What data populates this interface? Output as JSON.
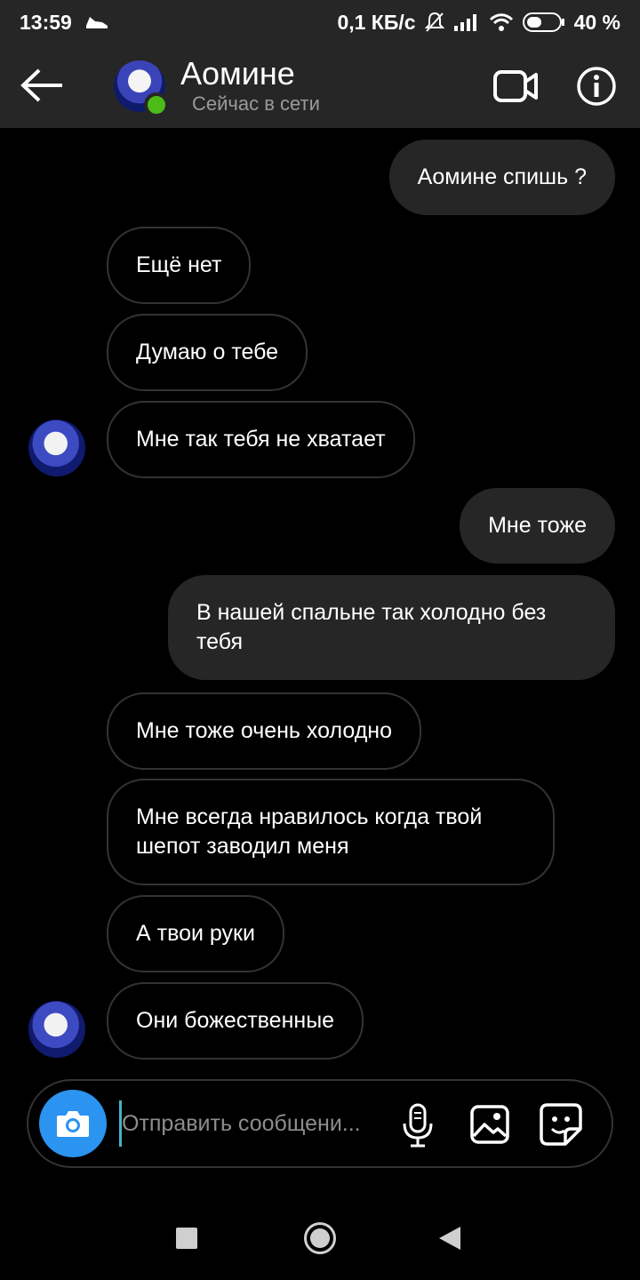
{
  "status_bar": {
    "time": "13:59",
    "speed": "0,1 КБ/с",
    "battery": "40 %",
    "icons": [
      "sneaker-icon",
      "mute-icon",
      "signal-icon",
      "wifi-icon",
      "battery-icon"
    ]
  },
  "header": {
    "contact_name": "Аомине",
    "status": "Сейчас в сети",
    "online_color": "#4cbb17"
  },
  "messages": [
    {
      "side": "out",
      "text": "Аомине спишь ?"
    },
    {
      "side": "in",
      "text": "Ещё нет"
    },
    {
      "side": "in",
      "text": "Думаю о тебе"
    },
    {
      "side": "in",
      "text": "Мне так тебя не хватает"
    },
    {
      "side": "out",
      "text": "Мне тоже"
    },
    {
      "side": "out",
      "text": "В нашей спальне так холодно без тебя"
    },
    {
      "side": "in",
      "text": "Мне тоже очень холодно"
    },
    {
      "side": "in",
      "text": "Мне всегда нравилось когда твой шепот заводил меня"
    },
    {
      "side": "in",
      "text": "А твои руки"
    },
    {
      "side": "in",
      "text": "Они божественные"
    }
  ],
  "composer": {
    "placeholder": "Отправить сообщени...",
    "accent_color": "#2b93f0"
  },
  "colors": {
    "bar_bg": "#262626",
    "outgoing_bubble": "#262626",
    "incoming_border": "#333333"
  }
}
